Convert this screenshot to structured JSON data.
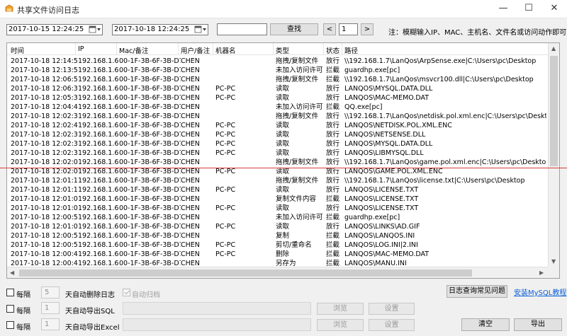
{
  "window": {
    "title": "共享文件访问日志",
    "minimize": "—",
    "maximize": "☐",
    "close": "✕"
  },
  "toolbar": {
    "start_date": "2017-10-15 12:24:25",
    "end_date": "2017-10-18 12:24:25",
    "search_value": "",
    "search_label": "查找",
    "prev_label": "<",
    "page": "1",
    "next_label": ">",
    "hint": "注：模糊输入IP、MAC、主机名、文件名或访问动作即可"
  },
  "table": {
    "columns": [
      "时间",
      "IP",
      "Mac/备注",
      "用户/备注",
      "机器名",
      "类型",
      "状态",
      "路径"
    ],
    "rows": [
      [
        "2017-10-18 12:14:52",
        "192.168.1.6",
        "00-1F-3B-6F-3B-D7",
        "CHEN",
        "",
        "拖拽/复制文件",
        "放行",
        "\\\\192.168.1.7\\LanQos\\ArpSense.exe|C:\\Users\\pc\\Desktop"
      ],
      [
        "2017-10-18 12:13:50",
        "192.168.1.6",
        "00-1F-3B-6F-3B-D7",
        "CHEN",
        "",
        "未加入访问许可",
        "拦截",
        "guardhp.exe[pc]"
      ],
      [
        "2017-10-18 12:06:50",
        "192.168.1.6",
        "00-1F-3B-6F-3B-D7",
        "CHEN",
        "",
        "拖拽/复制文件",
        "拦截",
        "\\\\192.168.1.7\\LanQos\\msvcr100.dll|C:\\Users\\pc\\Desktop"
      ],
      [
        "2017-10-18 12:06:31",
        "192.168.1.6",
        "00-1F-3B-6F-3B-D7",
        "CHEN",
        "PC-PC",
        "读取",
        "放行",
        "LANQOS\\MYSQL.DATA.DLL"
      ],
      [
        "2017-10-18 12:05:31",
        "192.168.1.6",
        "00-1F-3B-6F-3B-D7",
        "CHEN",
        "PC-PC",
        "读取",
        "放行",
        "LANQOS\\MAC-MEMO.DAT"
      ],
      [
        "2017-10-18 12:04:43",
        "192.168.1.6",
        "00-1F-3B-6F-3B-D7",
        "CHEN",
        "",
        "未加入访问许可",
        "拦截",
        "QQ.exe[pc]"
      ],
      [
        "2017-10-18 12:02:39",
        "192.168.1.6",
        "00-1F-3B-6F-3B-D7",
        "CHEN",
        "",
        "拖拽/复制文件",
        "放行",
        "\\\\192.168.1.7\\LanQos\\netdisk.pol.xml.enc|C:\\Users\\pc\\Desktop"
      ],
      [
        "2017-10-18 12:02:42",
        "192.168.1.6",
        "00-1F-3B-6F-3B-D7",
        "CHEN",
        "PC-PC",
        "读取",
        "放行",
        "LANQOS\\NETDISK.POL.XML.ENC"
      ],
      [
        "2017-10-18 12:02:39",
        "192.168.1.6",
        "00-1F-3B-6F-3B-D7",
        "CHEN",
        "PC-PC",
        "读取",
        "放行",
        "LANQOS\\NETSENSE.DLL"
      ],
      [
        "2017-10-18 12:02:39",
        "192.168.1.6",
        "00-1F-3B-6F-3B-D7",
        "CHEN",
        "PC-PC",
        "读取",
        "放行",
        "LANQOS\\MYSQL.DATA.DLL"
      ],
      [
        "2017-10-18 12:02:39",
        "192.168.1.6",
        "00-1F-3B-6F-3B-D7",
        "CHEN",
        "PC-PC",
        "读取",
        "放行",
        "LANQOS\\LIBMYSQL.DLL"
      ],
      [
        "2017-10-18 12:02:05",
        "192.168.1.6",
        "00-1F-3B-6F-3B-D7",
        "CHEN",
        "",
        "拖拽/复制文件",
        "放行",
        "\\\\192.168.1.7\\LanQos\\game.pol.xml.enc|C:\\Users\\pc\\Desktop"
      ],
      [
        "2017-10-18 12:02:08",
        "192.168.1.6",
        "00-1F-3B-6F-3B-D7",
        "CHEN",
        "PC-PC",
        "读取",
        "放行",
        "LANQOS\\GAME.POL.XML.ENC"
      ],
      [
        "2017-10-18 12:01:14",
        "192.168.1.6",
        "00-1F-3B-6F-3B-D7",
        "CHEN",
        "",
        "拖拽/复制文件",
        "放行",
        "\\\\192.168.1.7\\LanQos\\license.txt|C:\\Users\\pc\\Desktop"
      ],
      [
        "2017-10-18 12:01:17",
        "192.168.1.6",
        "00-1F-3B-6F-3B-D7",
        "CHEN",
        "PC-PC",
        "读取",
        "放行",
        "LANQOS\\LICENSE.TXT"
      ],
      [
        "2017-10-18 12:01:05",
        "192.168.1.6",
        "00-1F-3B-6F-3B-D7",
        "CHEN",
        "",
        "复制文件内容",
        "拦截",
        "LANQOS\\LICENSE.TXT"
      ],
      [
        "2017-10-18 12:01:06",
        "192.168.1.6",
        "00-1F-3B-6F-3B-D7",
        "CHEN",
        "PC-PC",
        "读取",
        "放行",
        "LANQOS\\LICENSE.TXT"
      ],
      [
        "2017-10-18 12:00:59",
        "192.168.1.6",
        "00-1F-3B-6F-3B-D7",
        "CHEN",
        "",
        "未加入访问许可",
        "拦截",
        "guardhp.exe[pc]"
      ],
      [
        "2017-10-18 12:01:00",
        "192.168.1.6",
        "00-1F-3B-6F-3B-D7",
        "CHEN",
        "PC-PC",
        "读取",
        "放行",
        "LANQOS\\LINKS\\AD.GIF"
      ],
      [
        "2017-10-18 12:00:55",
        "192.168.1.6",
        "00-1F-3B-6F-3B-D7",
        "CHEN",
        "",
        "复制",
        "拦截",
        "LANQOS\\LANQOS.INI"
      ],
      [
        "2017-10-18 12:00:53",
        "192.168.1.6",
        "00-1F-3B-6F-3B-D7",
        "CHEN",
        "PC-PC",
        "剪切/重命名",
        "拦截",
        "LANQOS\\LOG.INI|2.INI"
      ],
      [
        "2017-10-18 12:00:47",
        "192.168.1.6",
        "00-1F-3B-6F-3B-D7",
        "CHEN",
        "PC-PC",
        "删除",
        "拦截",
        "LANQOS\\MAC-MEMO.DAT"
      ],
      [
        "2017-10-18 12:00:40",
        "192.168.1.6",
        "00-1F-3B-6F-3B-D7",
        "CHEN",
        "",
        "另存为",
        "拦截",
        "LANQOS\\MANU.INI"
      ]
    ]
  },
  "bottom": {
    "every_label": "每隔",
    "auto_delete_days": "5",
    "auto_delete_label": "天自动删除日志",
    "auto_archive_label": "自动归档",
    "export_sql_days": "1",
    "export_sql_label": "天自动导出SQL",
    "export_excel_days": "1",
    "export_excel_label": "天自动导出Excel",
    "browse_label": "浏览",
    "settings_label": "设置",
    "faq_label": "日志查询常见问题",
    "mysql_tutorial_label": "安装MySQL教程",
    "clear_label": "清空",
    "export_label": "导出"
  },
  "colors": {
    "highlight_line": "#d83a3a",
    "link": "#0b5fd6"
  }
}
